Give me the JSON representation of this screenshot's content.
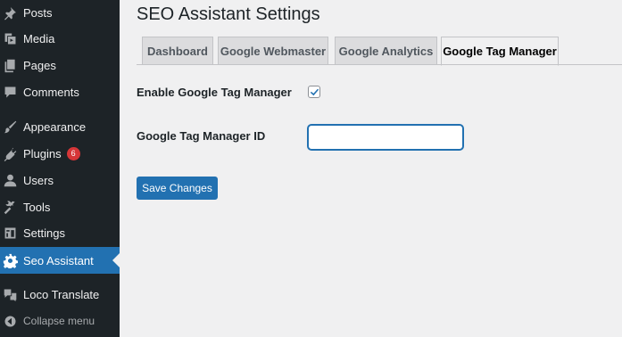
{
  "sidebar": {
    "items": [
      {
        "label": "Posts",
        "icon": "pushpin-icon"
      },
      {
        "label": "Media",
        "icon": "media-icon"
      },
      {
        "label": "Pages",
        "icon": "pages-icon"
      },
      {
        "label": "Comments",
        "icon": "comment-icon"
      },
      {
        "label": "Appearance",
        "icon": "paintbrush-icon"
      },
      {
        "label": "Plugins",
        "icon": "plugin-icon",
        "badge": "6"
      },
      {
        "label": "Users",
        "icon": "user-icon"
      },
      {
        "label": "Tools",
        "icon": "wrench-icon"
      },
      {
        "label": "Settings",
        "icon": "settings-icon"
      },
      {
        "label": "Seo Assistant",
        "icon": "gear-icon",
        "active": true
      },
      {
        "label": "Loco Translate",
        "icon": "translate-icon"
      }
    ],
    "collapse_label": "Collapse menu"
  },
  "page": {
    "title": "SEO Assistant Settings"
  },
  "tabs": [
    {
      "label": "Dashboard"
    },
    {
      "label": "Google Webmaster"
    },
    {
      "label": "Google Analytics"
    },
    {
      "label": "Google Tag Manager",
      "active": true
    }
  ],
  "form": {
    "enable_label": "Enable Google Tag Manager",
    "enable_checked": true,
    "id_label": "Google Tag Manager ID",
    "id_value": "",
    "save_label": "Save Changes"
  },
  "colors": {
    "sidebar_bg": "#1d2327",
    "accent": "#2271b1",
    "badge": "#d63638",
    "page_bg": "#f0f0f1"
  }
}
